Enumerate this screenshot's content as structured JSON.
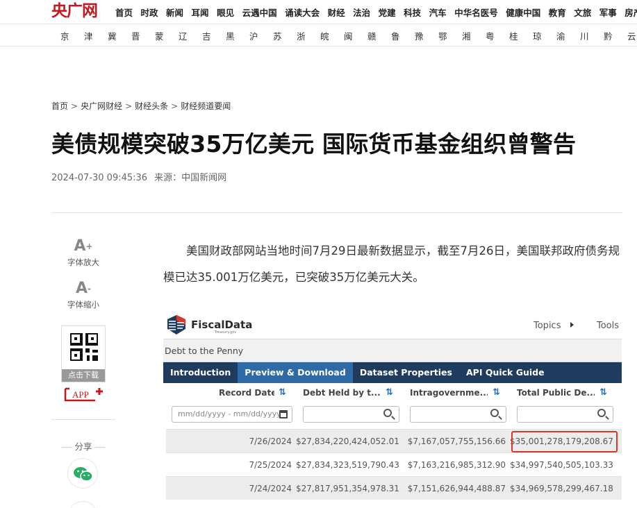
{
  "site": {
    "logo": "央广网",
    "menu": [
      "首页",
      "时政",
      "新闻",
      "耳闻",
      "眼见",
      "云遇中国",
      "诵读大会",
      "财经",
      "法治",
      "党建",
      "科技",
      "汽车",
      "中华名医号",
      "健康中国",
      "教育",
      "文旅",
      "军事",
      "房产"
    ],
    "regions": [
      "京",
      "津",
      "冀",
      "晋",
      "蒙",
      "辽",
      "吉",
      "黑",
      "沪",
      "苏",
      "浙",
      "皖",
      "闽",
      "赣",
      "鲁",
      "豫",
      "鄂",
      "湘",
      "粤",
      "桂",
      "琼",
      "渝",
      "川",
      "黔",
      "云"
    ]
  },
  "breadcrumb": [
    "首页",
    "央广网财经",
    "财经头条",
    "财经频道要闻"
  ],
  "breadcrumb_sep": ">",
  "article": {
    "title": "美债规模突破35万亿美元 国际货币基金组织曾警告",
    "datetime": "2024-07-30 09:45:36",
    "source": "来源：中国新闻网",
    "paragraph": "美国财政部网站当地时间7月29日最新数据显示，截至7月26日，美国联邦政府债务规模已达35.001万亿美元，已突破35万亿美元大关。"
  },
  "tools": {
    "font_up_glyph": "A",
    "font_up_sup": "+",
    "font_up_label": "字体放大",
    "font_down_glyph": "A",
    "font_down_sup": "-",
    "font_down_label": "字体缩小",
    "qr_label": "点击下载",
    "app_label": "APP",
    "share_label": "分享"
  },
  "fiscaldata": {
    "brand": "FiscalData",
    "brand_sub": "Treasury.gov",
    "nav": [
      "Topics",
      "Tools"
    ],
    "dataset_title": "Debt to the Penny",
    "tabs": [
      "Introduction",
      "Preview & Download",
      "Dataset Properties",
      "API Quick Guide"
    ],
    "active_tab": 1,
    "columns": [
      "Record Date",
      "Debt Held by t...",
      "Intragovernme...",
      "Total Public De..."
    ],
    "date_filter_placeholder": "mm/dd/yyyy - mm/dd/yyyy",
    "rows": [
      [
        "7/26/2024",
        "$27,834,220,424,052.01",
        "$7,167,057,755,156.66",
        "$35,001,278,179,208.67"
      ],
      [
        "7/25/2024",
        "$27,834,323,519,790.43",
        "$7,163,216,985,312.90",
        "$34,997,540,505,103.33"
      ],
      [
        "7/24/2024",
        "$27,817,951,354,978.31",
        "$7,151,626,944,488.87",
        "$34,969,578,299,467.18"
      ]
    ],
    "sort_glyph": "⇅"
  },
  "colors": {
    "brand_red": "#c8161d",
    "fd_navy": "#1f3c5f",
    "fd_blue": "#2d6aa6",
    "highlight": "#d9362e",
    "wechat": "#2aae67"
  }
}
